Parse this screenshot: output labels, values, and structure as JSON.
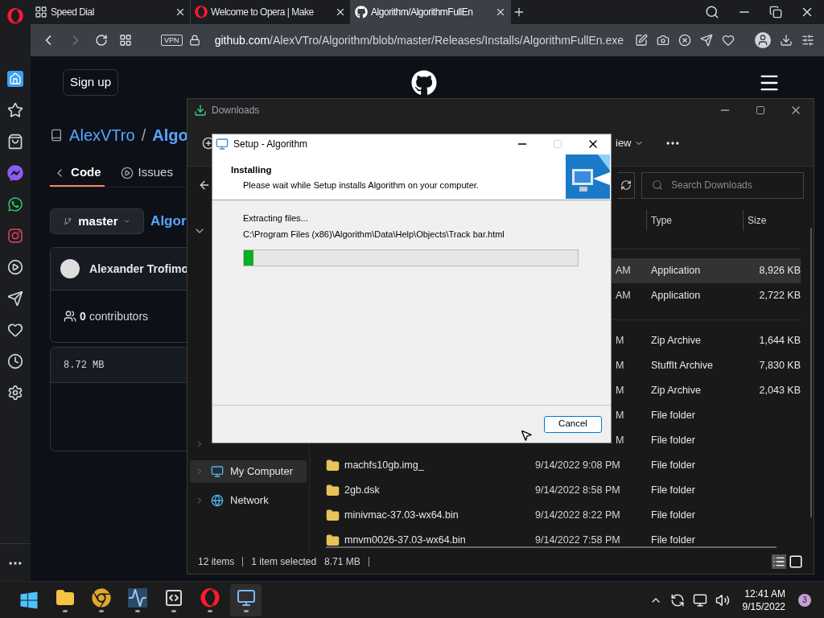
{
  "browser": {
    "tabs": [
      {
        "title": "Speed Dial",
        "selected": false
      },
      {
        "title": "Welcome to Opera | Make",
        "selected": false
      },
      {
        "title": "Algorithm/AlgorithmFullEn",
        "selected": true
      }
    ],
    "address": {
      "vpn": "VPN",
      "host": "github.com",
      "path": "/AlexVTro/Algorithm/blob/master/Releases/Installs/AlgorithmFullEn.exe"
    }
  },
  "github": {
    "sign_up": "Sign up",
    "owner": "AlexVTro",
    "separator": "/",
    "repo": "Algo",
    "tabs": [
      {
        "label": "Code",
        "selected": true
      },
      {
        "label": "Issues",
        "selected": false
      }
    ],
    "branch": "master",
    "path_link": "Algor",
    "author": "Alexander Trofimo",
    "contributors_count": "0",
    "contributors_label": "contributors",
    "file_size": "8.72 MB"
  },
  "downloads": {
    "title": "Downloads",
    "view_menu": "iew",
    "search": {
      "placeholder": "Search Downloads"
    },
    "columns": [
      {
        "label": "Type"
      },
      {
        "label": "Size"
      }
    ],
    "nav": [
      {
        "label": "My Computer",
        "selected": true
      },
      {
        "label": "Network",
        "selected": false
      }
    ],
    "groups": [
      {
        "rows": [
          {
            "date": "AM",
            "type": "Application",
            "size": "8,926 KB",
            "selected": true
          },
          {
            "date": "AM",
            "type": "Application",
            "size": "2,722 KB",
            "selected": false
          }
        ]
      },
      {
        "rows": [
          {
            "date": "M",
            "type": "Zip Archive",
            "size": "1,644 KB",
            "selected": false
          },
          {
            "date": "M",
            "type": "StuffIt Archive",
            "size": "7,830 KB",
            "selected": false
          },
          {
            "date": "M",
            "type": "Zip Archive",
            "size": "2,043 KB",
            "selected": false
          },
          {
            "date": "M",
            "type": "File folder",
            "selected": false
          },
          {
            "date": "M",
            "type": "File folder",
            "selected": false
          },
          {
            "name": "machfs10gb.img_",
            "date": "9/14/2022 9:08 PM",
            "type": "File folder",
            "selected": false
          },
          {
            "name": "2gb.dsk",
            "date": "9/14/2022 8:58 PM",
            "type": "File folder",
            "selected": false
          },
          {
            "name": "minivmac-37.03-wx64.bin",
            "date": "9/14/2022 8:22 PM",
            "type": "File folder",
            "selected": false
          },
          {
            "name": "mnvm0026-37.03-wx64.bin",
            "date": "9/14/2022 7:58 PM",
            "type": "File folder",
            "selected": false
          }
        ]
      }
    ],
    "status": {
      "count": "12 items",
      "selection": "1 item selected",
      "size": "8.71 MB"
    }
  },
  "setup": {
    "title": "Setup - Algorithm",
    "heading": "Installing",
    "subtitle": "Please wait while Setup installs Algorithm on your computer.",
    "status": "Extracting files...",
    "file": "C:\\Program Files (x86)\\Algorithm\\Data\\Help\\Objects\\Track bar.html",
    "progress": {
      "level": 0.03
    },
    "cancel": "Cancel"
  },
  "taskbar": {
    "apps": [
      {
        "kind": "start",
        "selected": false
      },
      {
        "kind": "explorer",
        "selected": false
      },
      {
        "kind": "chrome",
        "selected": false
      },
      {
        "kind": "monitor",
        "selected": false
      },
      {
        "kind": "editor",
        "selected": false
      },
      {
        "kind": "opera",
        "selected": false
      },
      {
        "kind": "setup",
        "selected": true
      }
    ],
    "time": "12:41 AM",
    "date": "9/15/2022",
    "notifications": "3"
  }
}
